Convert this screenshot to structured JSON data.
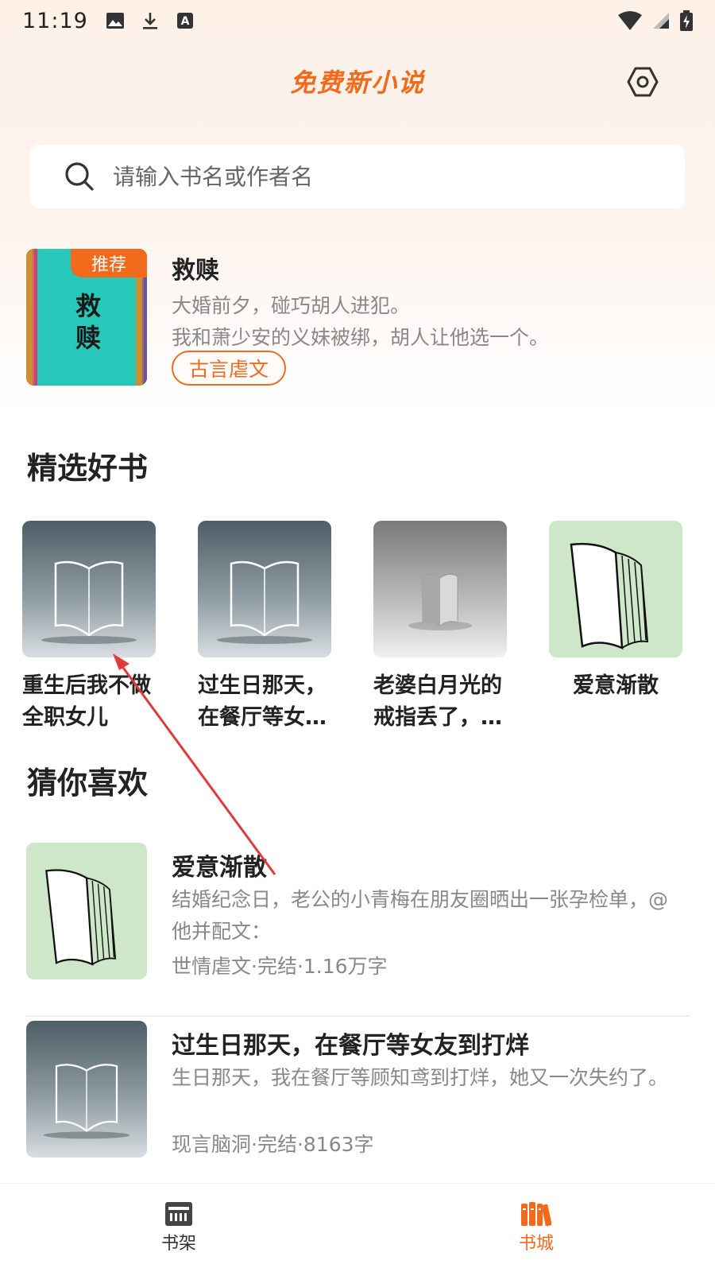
{
  "status_bar": {
    "time": "11:19",
    "left_icons": [
      "image-icon",
      "download-icon",
      "text-a-icon"
    ],
    "right_icons": [
      "wifi-icon",
      "cell-signal-icon",
      "battery-icon"
    ]
  },
  "header": {
    "title": "免费新小说",
    "settings_icon": "settings-hex-icon",
    "accent_color": "#f26a1b"
  },
  "search": {
    "placeholder": "请输入书名或作者名"
  },
  "recommended": {
    "badge": "推荐",
    "cover_text": "救赎",
    "title": "救赎",
    "desc_line1": "大婚前夕，碰巧胡人进犯。",
    "desc_line2": "我和萧少安的义妹被绑，胡人让他选一个。",
    "tag": "古言虐文"
  },
  "featured": {
    "heading": "精选好书",
    "books": [
      {
        "name": "重生后我不做全职女儿"
      },
      {
        "name": "过生日那天，在餐厅等女…"
      },
      {
        "name": "老婆白月光的戒指丢了，…"
      },
      {
        "name": "爱意渐散"
      }
    ]
  },
  "guess": {
    "heading": "猜你喜欢",
    "items": [
      {
        "title": "爱意渐散",
        "desc": "结婚纪念日，老公的小青梅在朋友圈晒出一张孕检单，@他并配文：",
        "meta": "世情虐文·完结·1.16万字"
      },
      {
        "title": "过生日那天，在餐厅等女友到打烊",
        "desc": "生日那天，我在餐厅等顾知鸢到打烊，她又一次失约了。",
        "meta": "现言脑洞·完结·8163字"
      }
    ]
  },
  "bottom_nav": {
    "bookshelf_label": "书架",
    "bookstore_label": "书城",
    "active": "书城"
  }
}
